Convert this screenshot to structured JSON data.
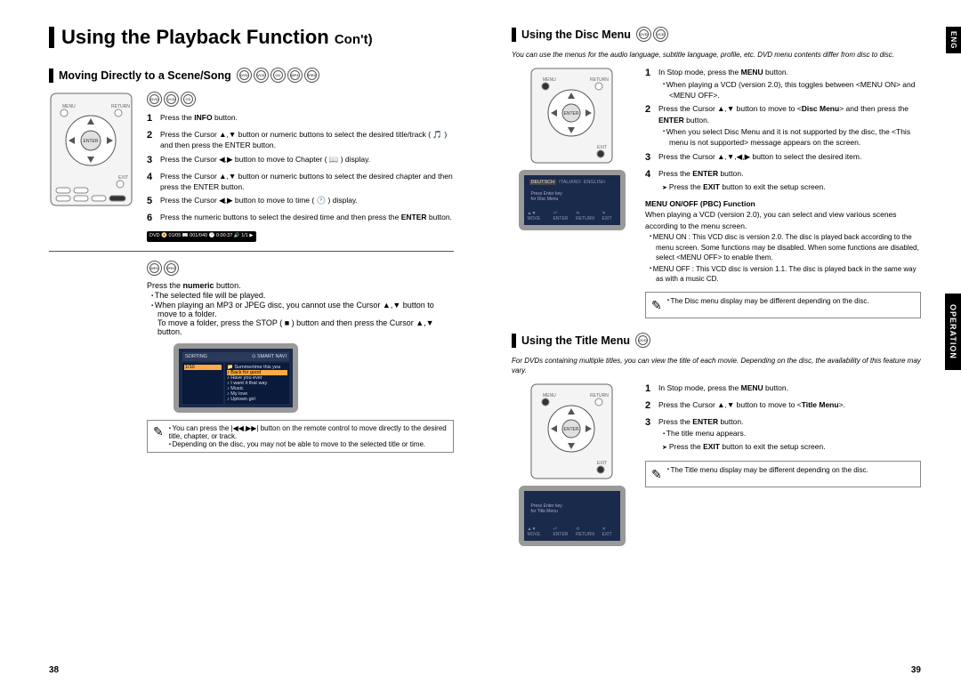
{
  "lang_tab": "ENG",
  "section_tab": "OPERATION",
  "page_left_num": "38",
  "page_right_num": "39",
  "main_title": "Using the Playback Function",
  "main_title_suffix": "Con't)",
  "s1": {
    "title": "Moving Directly to a Scene/Song",
    "formats_a": [
      "DVD",
      "VCD",
      "CD"
    ],
    "step1": "Press the INFO button.",
    "step2": "Press the Cursor ▲,▼ button or numeric buttons to select the desired title/track ( 🎵 ) and then press the ENTER button.",
    "step3": "Press the Cursor ◀,▶ button to move to Chapter ( 📖 ) display.",
    "step4": "Press the Cursor ▲,▼ button or numeric buttons to select the desired chapter and then press the ENTER button.",
    "step5": "Press the Cursor ◀,▶ button to move to time ( 🕐 ) display.",
    "step6": "Press the numeric buttons to select the desired time and then press the ENTER button.",
    "info_strip": "DVD 📀 01/05 📖 001/040 🕐 0:00:37 🔊 1/1 ▶",
    "formats_b": [
      "MP3",
      "JPEG"
    ],
    "b_line1": "Press the numeric button.",
    "b_bullet1": "The selected file will be played.",
    "b_bullet2": "When playing an MP3 or JPEG disc, you cannot use the Cursor ▲,▼ button to move to a folder.",
    "b_bullet2b": "To move a folder, press the STOP ( ■ ) button and then press the Cursor ▲,▼ button.",
    "tip1": "You can press the |◀◀,▶▶| button on the remote control to move directly to the desired title, chapter, or track.",
    "tip2": "Depending on the disc, you may not be able to move to the selected title or time."
  },
  "s2": {
    "title": "Using the Disc Menu",
    "note": "You can use the menus for the audio language, subtitle language, profile, etc.\nDVD menu contents differ from disc to disc.",
    "step1": "In Stop mode, press the MENU button.",
    "step1_b1": "When playing a VCD (version 2.0), this toggles between <MENU ON> and <MENU OFF>.",
    "step2": "Press the Cursor ▲,▼ button to move to <Disc Menu> and then press the ENTER button.",
    "step2_b1": "When you select Disc Menu and it is not supported by the disc, the <This menu is not supported> message appears on the screen.",
    "step3": "Press the Cursor ▲,▼,◀,▶ button to select the desired item.",
    "step4": "Press the ENTER button.",
    "exit": "Press the EXIT button to exit the setup screen.",
    "pbc_head": "MENU ON/OFF (PBC) Function",
    "pbc_body": "When playing a VCD (version 2.0), you can select and view various scenes according to the menu screen.",
    "pbc_on": "MENU ON : This VCD disc is version 2.0. The disc is played back according to the menu screen. Some functions may be disabled. When some functions are disabled, select <MENU OFF> to enable them.",
    "pbc_off": "MENU OFF : This VCD disc is version 1.1. The disc is played back in the same way as with a music CD.",
    "tip": "The Disc menu display may be different depending on the disc."
  },
  "s3": {
    "title": "Using the Title Menu",
    "note": "For DVDs containing multiple titles, you can view the title of each movie. Depending on the disc, the availability of this feature may vary.",
    "step1": "In Stop mode, press the MENU button.",
    "step2": "Press the Cursor ▲,▼ button to move to <Title Menu>.",
    "step3": "Press the ENTER button.",
    "step3_b1": "The title menu appears.",
    "exit": "Press the EXIT button to exit the setup screen.",
    "tip": "The Title menu display may be different depending on the disc."
  }
}
